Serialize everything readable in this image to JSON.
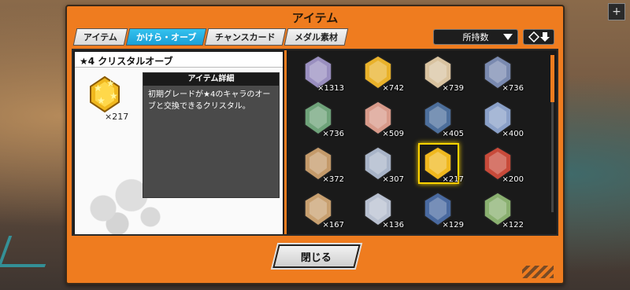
{
  "dialog": {
    "title": "アイテム",
    "close_label": "閉じる"
  },
  "tabs": [
    {
      "label": "アイテム",
      "active": false
    },
    {
      "label": "かけら・オーブ",
      "active": true
    },
    {
      "label": "チャンスカード",
      "active": false
    },
    {
      "label": "メダル素材",
      "active": false
    }
  ],
  "sort": {
    "selected": "所持数",
    "order_icon": "sort-order-icon"
  },
  "detail": {
    "title": "★4 クリスタルオーブ",
    "count": "×217",
    "info_header": "アイテム詳細",
    "description": "初期グレードが★4のキャラのオーブと交換できるクリスタル。"
  },
  "items": [
    {
      "name": "orb-character-1",
      "qty": "×1313",
      "color": "#9a8fc0"
    },
    {
      "name": "crystal-gold",
      "qty": "×742",
      "color": "#e9b22b"
    },
    {
      "name": "orb-character-2",
      "qty": "×739",
      "color": "#d9c3a0"
    },
    {
      "name": "orb-character-3",
      "qty": "×736",
      "color": "#7a8ab0"
    },
    {
      "name": "orb-character-4",
      "qty": "×736",
      "color": "#6fa37a"
    },
    {
      "name": "orb-character-5",
      "qty": "×509",
      "color": "#d89a8a"
    },
    {
      "name": "orb-character-6",
      "qty": "×405",
      "color": "#4d6f9c"
    },
    {
      "name": "orb-character-7",
      "qty": "×400",
      "color": "#8aa0c8"
    },
    {
      "name": "crystal-bronze",
      "qty": "×372",
      "color": "#c49a6a"
    },
    {
      "name": "crystal-silver",
      "qty": "×307",
      "color": "#a8b4c8"
    },
    {
      "name": "crystal-star4",
      "qty": "×217",
      "color": "#f0b81e",
      "selected": true
    },
    {
      "name": "orb-character-8",
      "qty": "×200",
      "color": "#c84a3a"
    },
    {
      "name": "crystal-bronze-star",
      "qty": "×167",
      "color": "#c8a070"
    },
    {
      "name": "crystal-silver-star",
      "qty": "×136",
      "color": "#b8c0d0"
    },
    {
      "name": "orb-character-9",
      "qty": "×129",
      "color": "#4a6aa0"
    },
    {
      "name": "orb-character-10",
      "qty": "×122",
      "color": "#8ab070"
    }
  ]
}
